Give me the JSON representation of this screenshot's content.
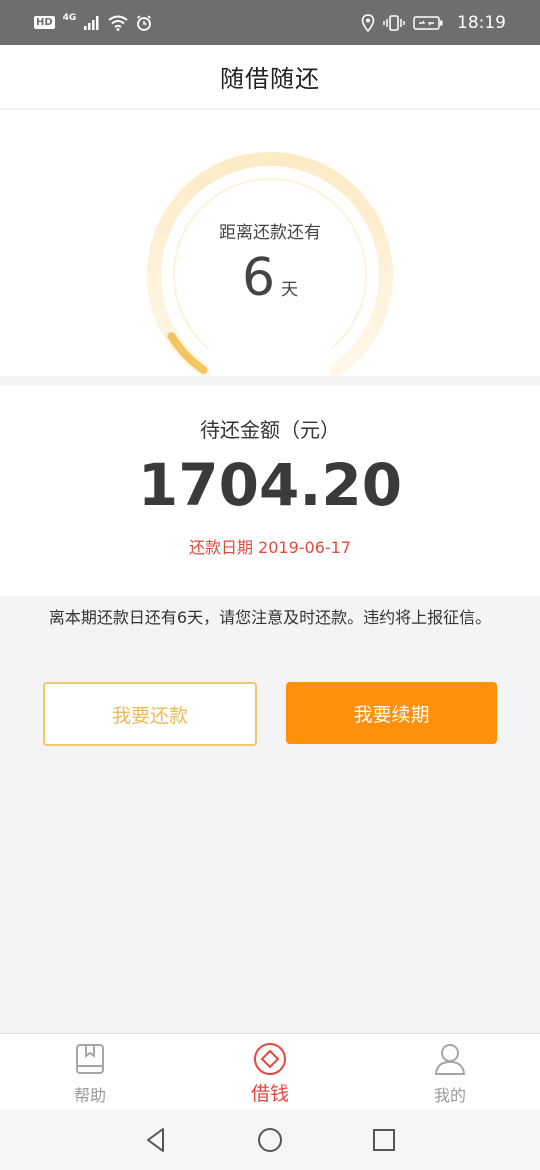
{
  "status_bar": {
    "hd": "HD",
    "network": "4G",
    "time": "18:19"
  },
  "header": {
    "title": "随借随还"
  },
  "countdown": {
    "label": "距离还款还有",
    "days": "6",
    "unit": "天",
    "elapsed_fraction": 0.08,
    "track_color": "#fdf0d7",
    "progress_color": "#f3c562"
  },
  "amount": {
    "label": "待还金额（元）",
    "value": "1704.20",
    "due_date_text": "还款日期 2019-06-17"
  },
  "notice": "离本期还款日还有6天，请您注意及时还款。违约将上报征信。",
  "buttons": {
    "repay": "我要还款",
    "renew": "我要续期"
  },
  "tabs": [
    {
      "label": "帮助",
      "icon": "book-icon",
      "active": false
    },
    {
      "label": "借钱",
      "icon": "diamond-icon",
      "active": true
    },
    {
      "label": "我的",
      "icon": "user-icon",
      "active": false
    }
  ],
  "colors": {
    "accent": "#ff9009",
    "active_tab": "#e8453c",
    "due_date": "#e24a3d"
  }
}
